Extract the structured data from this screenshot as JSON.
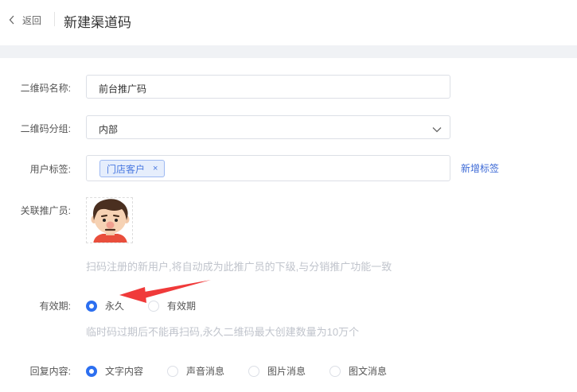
{
  "header": {
    "back_label": "返回",
    "title": "新建渠道码"
  },
  "form": {
    "name": {
      "label": "二维码名称:",
      "value": "前台推广码"
    },
    "group": {
      "label": "二维码分组:",
      "value": "内部"
    },
    "tags": {
      "label": "用户标签:",
      "items": [
        {
          "text": "门店客户",
          "remove": "×"
        }
      ],
      "add_link": "新增标签"
    },
    "promoter": {
      "label": "关联推广员:",
      "hint": "扫码注册的新用户,将自动成为此推广员的下级,与分销推广功能一致"
    },
    "validity": {
      "label": "有效期:",
      "options": [
        {
          "text": "永久",
          "selected": true
        },
        {
          "text": "有效期",
          "selected": false
        }
      ],
      "hint": "临时码过期后不能再扫码,永久二维码最大创建数量为10万个"
    },
    "reply": {
      "label": "回复内容:",
      "options": [
        {
          "text": "文字内容",
          "selected": true
        },
        {
          "text": "声音消息",
          "selected": false
        },
        {
          "text": "图片消息",
          "selected": false
        },
        {
          "text": "图文消息",
          "selected": false
        }
      ]
    }
  },
  "colors": {
    "primary": "#2c6ff0",
    "annotation_arrow": "#f03a3a",
    "hint": "#c0c4cc"
  },
  "icons": {
    "back": "chevron-left-icon",
    "select": "chevron-down-icon"
  }
}
